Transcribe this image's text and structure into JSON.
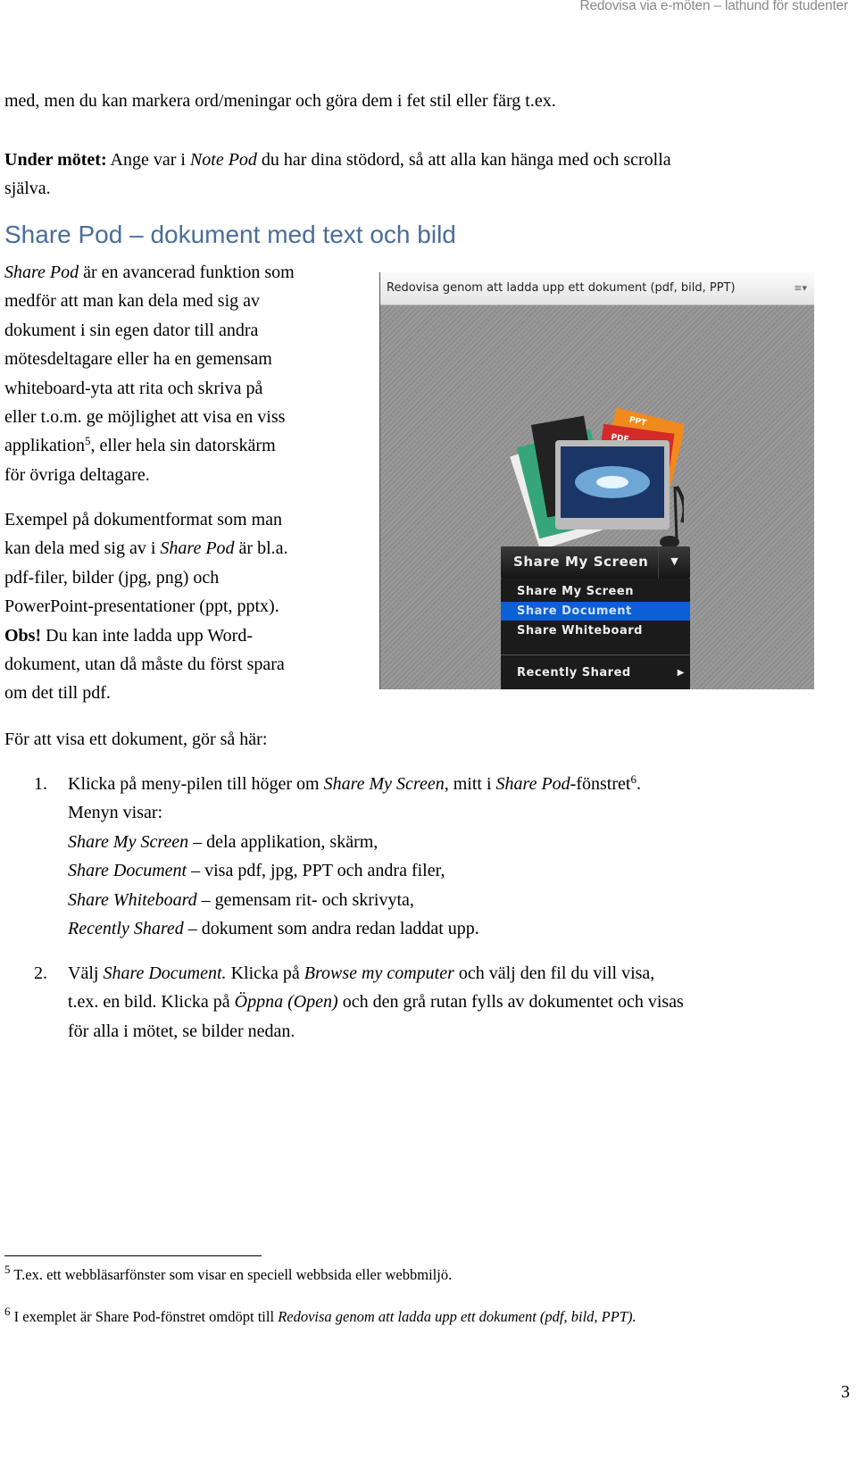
{
  "header": "Redovisa via e-möten – lathund för studenter",
  "p1": {
    "a": "med, men du kan markera ord/meningar och göra dem i fet stil eller färg t.ex."
  },
  "p2": {
    "bold": "Under mötet:",
    "a": " Ange var i ",
    "it": "Note Pod",
    "b": " du har dina stödord, så att alla kan hänga med och scrolla",
    "c": "själva."
  },
  "heading": "Share Pod – dokument med text och bild",
  "p3": {
    "it": "Share Pod",
    "l1": " är en avancerad funktion som",
    "l2": "medför att man kan dela med sig av",
    "l3": "dokument i sin egen dator till andra",
    "l4": "mötesdeltagare eller ha en gemensam",
    "l5": "whiteboard-yta att rita och skriva på",
    "l6": "eller t.o.m. ge möjlighet att visa en viss",
    "l7a": "applikation",
    "fn": "5",
    "l7b": ", eller hela sin datorskärm",
    "l8": "för övriga deltagare."
  },
  "p4": {
    "l1": "Exempel på dokumentformat som man",
    "l2a": "kan dela med sig av i ",
    "l2it": "Share Pod",
    "l2b": " är bl.a.",
    "l3": "pdf-filer, bilder (jpg, png) och",
    "l4": "PowerPoint-presentationer (ppt, pptx).",
    "obs": "Obs!",
    "l5": " Du kan inte ladda upp Word-",
    "l6": "dokument, utan då måste du först spara",
    "l7": "om det till pdf."
  },
  "screenshot": {
    "title": "Redovisa genom att ladda upp ett dokument (pdf, bild, PPT)",
    "menu_icon": "menu-lines-icon",
    "button": "Share My Screen",
    "items": [
      "Share My Screen",
      "Share Document",
      "Share Whiteboard",
      "Recently Shared"
    ],
    "selected": "Share Document",
    "tags": [
      "PPT",
      "PDF"
    ],
    "colors": {
      "highlight": "#0b5fd7",
      "pdf": "#d42a2a",
      "ppt": "#f08a1c"
    }
  },
  "intro": "För att visa ett dokument, gör så här:",
  "steps": [
    {
      "num": "1.",
      "a": "Klicka på meny-pilen till höger om ",
      "it1": "Share My Screen",
      "b": ", mitt i ",
      "it2": "Share Pod",
      "c": "-fönstret",
      "fn": "6",
      "d": ".",
      "menu_intro": "Menyn visar:",
      "lines": [
        {
          "it": "Share My Screen",
          "t": " – dela applikation, skärm,"
        },
        {
          "it": "Share Document",
          "t": " – visa pdf, jpg, PPT och andra filer,"
        },
        {
          "it": "Share Whiteboard",
          "t": " – gemensam rit- och skrivyta,"
        },
        {
          "it": "Recently Shared",
          "t": " – dokument som andra redan laddat upp."
        }
      ]
    },
    {
      "num": "2.",
      "a": "Välj ",
      "it1": "Share Document.",
      "b": " Klicka på ",
      "it2": "Browse my computer",
      "c": " och välj den fil du vill visa,",
      "l2a": "t.ex. en bild. Klicka på ",
      "it3": "Öppna (Open)",
      "l2b": " och den grå rutan fylls av dokumentet och visas",
      "l3": "för alla i mötet, se bilder nedan."
    }
  ],
  "footnotes": [
    {
      "num": "5",
      "text": " T.ex. ett webbläsarfönster som visar en speciell webbsida eller webbmiljö."
    },
    {
      "num": "6",
      "text": " I exemplet är Share Pod-fönstret omdöpt till ",
      "it": "Redovisa genom att ladda upp ett dokument (pdf, bild, PPT)."
    }
  ],
  "page_number": "3"
}
